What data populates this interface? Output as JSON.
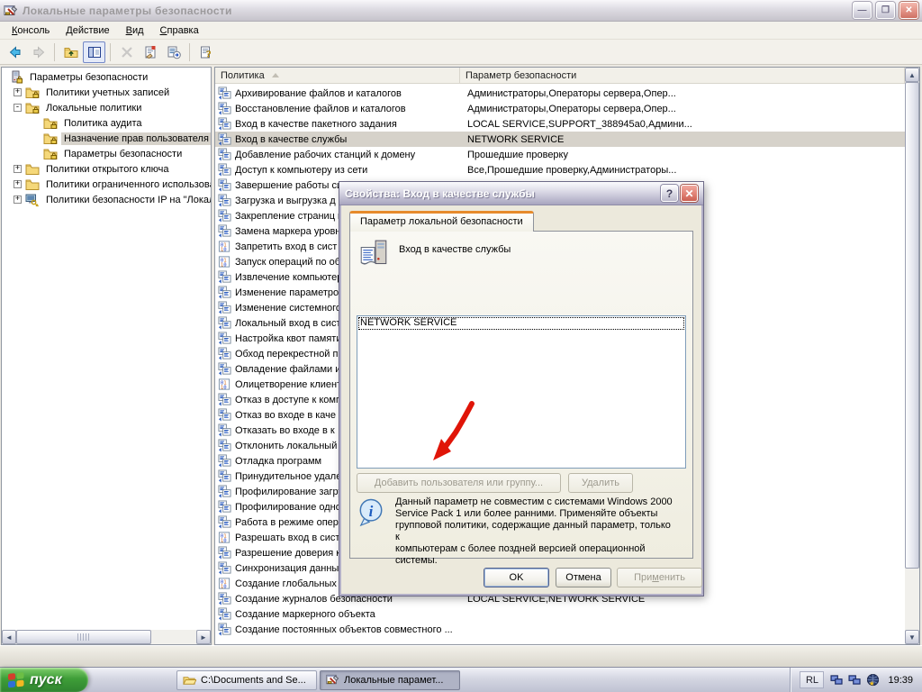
{
  "colors": {
    "accent_orange": "#E68B2C",
    "selection_gray": "#D6D2CA",
    "start_green": "#3F9E38",
    "close_red": "#CB5F52",
    "arrow_red": "#E01508"
  },
  "window": {
    "title": "Локальные параметры безопасности"
  },
  "menu": {
    "items": [
      {
        "id": "console",
        "parts": [
          "",
          "К",
          "онсоль"
        ]
      },
      {
        "id": "action",
        "parts": [
          "",
          "Д",
          "ействие"
        ]
      },
      {
        "id": "view",
        "parts": [
          "",
          "В",
          "ид"
        ]
      },
      {
        "id": "help",
        "parts": [
          "",
          "С",
          "правка"
        ]
      }
    ]
  },
  "toolbar": {
    "items": [
      {
        "name": "back-button",
        "icon": "back-icon"
      },
      {
        "name": "forward-button",
        "icon": "forward-icon",
        "disabled": true
      },
      {
        "sep": true
      },
      {
        "name": "up-one-level-button",
        "icon": "up-folder-icon"
      },
      {
        "name": "show-tree-button",
        "icon": "show-tree-icon",
        "pressed": true
      },
      {
        "sep": true
      },
      {
        "name": "delete-button",
        "icon": "delete-icon",
        "disabled": true
      },
      {
        "name": "properties-button",
        "icon": "properties-icon"
      },
      {
        "name": "export-list-button",
        "icon": "export-list-icon"
      },
      {
        "sep": true
      },
      {
        "name": "help-button",
        "icon": "help-icon"
      }
    ]
  },
  "tree": {
    "items": [
      {
        "label": "Параметры безопасности",
        "icon": "computer-lock-icon",
        "level": 0,
        "expander": null,
        "selected": false
      },
      {
        "label": "Политики учетных записей",
        "icon": "folder-lock-icon",
        "level": 1,
        "expander": "+",
        "selected": false
      },
      {
        "label": "Локальные политики",
        "icon": "folder-lock-icon",
        "level": 1,
        "expander": "-",
        "selected": false
      },
      {
        "label": "Политика аудита",
        "icon": "folder-lock-icon",
        "level": 2,
        "expander": null,
        "selected": false
      },
      {
        "label": "Назначение прав пользователя",
        "icon": "folder-lock-icon",
        "level": 2,
        "expander": null,
        "selected": true
      },
      {
        "label": "Параметры безопасности",
        "icon": "folder-lock-icon",
        "level": 2,
        "expander": null,
        "selected": false
      },
      {
        "label": "Политики открытого ключа",
        "icon": "folder-icon",
        "level": 1,
        "expander": "+",
        "selected": false
      },
      {
        "label": "Политики ограниченного использова",
        "icon": "folder-icon",
        "level": 1,
        "expander": "+",
        "selected": false
      },
      {
        "label": "Политики безопасности IP на \"Локал",
        "icon": "ipsec-icon",
        "level": 1,
        "expander": "+",
        "selected": false
      }
    ]
  },
  "list": {
    "columns": [
      "Политика",
      "Параметр безопасности"
    ],
    "rows": [
      {
        "icon": "policy-icon",
        "policy": "Архивирование файлов и каталогов",
        "value": "Администраторы,Операторы сервера,Опер...",
        "selected": false
      },
      {
        "icon": "policy-icon",
        "policy": "Восстановление файлов и каталогов",
        "value": "Администраторы,Операторы сервера,Опер...",
        "selected": false
      },
      {
        "icon": "policy-icon",
        "policy": "Вход в качестве пакетного задания",
        "value": "LOCAL SERVICE,SUPPORT_388945a0,Админи...",
        "selected": false
      },
      {
        "icon": "policy-icon",
        "policy": "Вход в качестве службы",
        "value": "NETWORK SERVICE",
        "selected": true
      },
      {
        "icon": "policy-icon",
        "policy": "Добавление рабочих станций к домену",
        "value": "Прошедшие проверку",
        "selected": false
      },
      {
        "icon": "policy-icon",
        "policy": "Доступ к компьютеру из сети",
        "value": "Все,Прошедшие проверку,Администраторы...",
        "selected": false
      },
      {
        "icon": "policy-icon",
        "policy": "Завершение работы си",
        "value": "",
        "selected": false
      },
      {
        "icon": "policy-icon",
        "policy": "Загрузка и выгрузка д",
        "value": "",
        "selected": false
      },
      {
        "icon": "policy-icon",
        "policy": "Закрепление страниц в",
        "value": "",
        "selected": false
      },
      {
        "icon": "policy-icon",
        "policy": "Замена маркера уровня",
        "value": "",
        "selected": false
      },
      {
        "icon": "binary-icon",
        "policy": "Запретить вход в сист",
        "value": "",
        "selected": false
      },
      {
        "icon": "binary-icon",
        "policy": "Запуск операций по об",
        "value": "",
        "selected": false
      },
      {
        "icon": "policy-icon",
        "policy": "Извлечение компьютер",
        "value": "",
        "selected": false
      },
      {
        "icon": "policy-icon",
        "policy": "Изменение параметров",
        "value": "",
        "selected": false
      },
      {
        "icon": "policy-icon",
        "policy": "Изменение системного",
        "value": "",
        "selected": false
      },
      {
        "icon": "policy-icon",
        "policy": "Локальный вход в сист",
        "value": "",
        "selected": false
      },
      {
        "icon": "policy-icon",
        "policy": "Настройка квот памяти",
        "value": "",
        "selected": false
      },
      {
        "icon": "policy-icon",
        "policy": "Обход перекрестной п",
        "value": "",
        "selected": false
      },
      {
        "icon": "policy-icon",
        "policy": "Овладение файлами ил",
        "value": "",
        "selected": false
      },
      {
        "icon": "binary-icon",
        "policy": "Олицетворение клиент",
        "value": "",
        "selected": false
      },
      {
        "icon": "policy-icon",
        "policy": "Отказ в доступе к комп",
        "value": "",
        "selected": false
      },
      {
        "icon": "policy-icon",
        "policy": "Отказ во входе в каче",
        "value": "",
        "selected": false
      },
      {
        "icon": "policy-icon",
        "policy": "Отказать во входе в к",
        "value": "",
        "selected": false
      },
      {
        "icon": "policy-icon",
        "policy": "Отклонить локальный",
        "value": "",
        "selected": false
      },
      {
        "icon": "policy-icon",
        "policy": "Отладка программ",
        "value": "",
        "selected": false
      },
      {
        "icon": "policy-icon",
        "policy": "Принудительное удале",
        "value": "",
        "selected": false
      },
      {
        "icon": "policy-icon",
        "policy": "Профилирование загру",
        "value": "",
        "selected": false
      },
      {
        "icon": "policy-icon",
        "policy": "Профилирование одно",
        "value": "",
        "selected": false
      },
      {
        "icon": "policy-icon",
        "policy": "Работа в режиме опера",
        "value": "",
        "selected": false
      },
      {
        "icon": "binary-icon",
        "policy": "Разрешать вход в сист",
        "value": "",
        "selected": false
      },
      {
        "icon": "policy-icon",
        "policy": "Разрешение доверия к",
        "value": "",
        "selected": false
      },
      {
        "icon": "policy-icon",
        "policy": "Синхронизация данных",
        "value": "",
        "selected": false
      },
      {
        "icon": "binary-icon",
        "policy": "Создание глобальных",
        "value": "",
        "selected": false
      },
      {
        "icon": "policy-icon",
        "policy": "Создание журналов безопасности",
        "value": "LOCAL SERVICE,NETWORK SERVICE",
        "selected": false
      },
      {
        "icon": "policy-icon",
        "policy": "Создание маркерного объекта",
        "value": "",
        "selected": false
      },
      {
        "icon": "policy-icon",
        "policy": "Создание постоянных объектов совместного ...",
        "value": "",
        "selected": false
      }
    ]
  },
  "dialog": {
    "title": "Свойства: Вход в качестве службы",
    "tab": "Параметр локальной безопасности",
    "policy_name": "Вход в качестве службы",
    "listbox_items": [
      "NETWORK SERVICE"
    ],
    "add_label": "Добавить пользователя или группу...",
    "remove_label": "Удалить",
    "info_text": "Данный параметр не совместим с системами Windows 2000\nService Pack 1 или более ранними. Применяйте объекты\nгрупповой политики, содержащие данный параметр, только к\nкомпьютерам с более поздней версией операционной\nсистемы.",
    "ok_label": "OK",
    "cancel_label": "Отмена",
    "apply_parts": [
      "При",
      "м",
      "енить"
    ]
  },
  "taskbar": {
    "start_label": "пуск",
    "buttons": [
      {
        "label": "C:\\Documents and Se...",
        "icon": "folder-open-icon",
        "active": false
      },
      {
        "label": "Локальные парамет...",
        "icon": "mmc-icon",
        "active": true
      }
    ],
    "tray": {
      "lang": "RL",
      "time": "19:39",
      "icons": [
        "network-icon",
        "network2-icon",
        "globe-icon"
      ]
    }
  }
}
